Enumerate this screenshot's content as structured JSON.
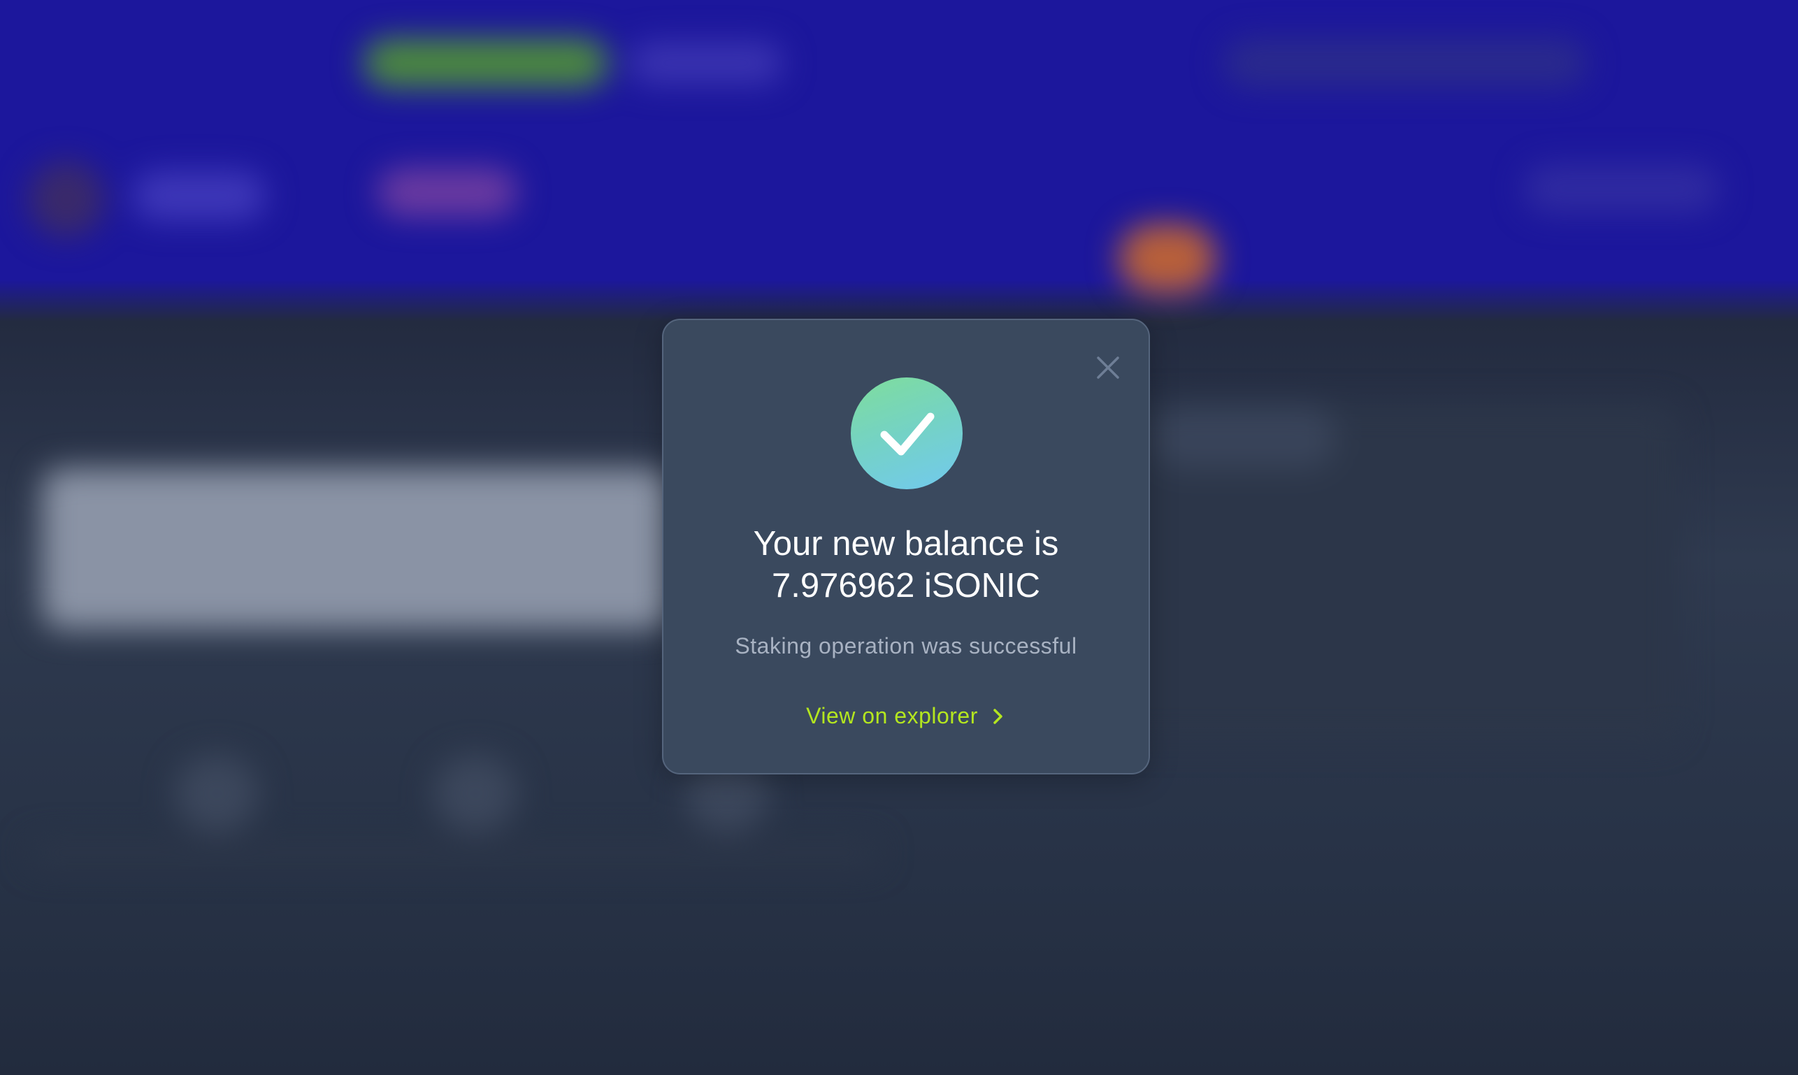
{
  "modal": {
    "title_line1": "Your new balance is",
    "title_line2": "7.976962 iSONIC",
    "subtitle": "Staking operation was successful",
    "explorer_link": "View on explorer",
    "close_icon": "close-icon",
    "success_icon": "checkmark-circle-icon",
    "chevron_icon": "chevron-right-icon"
  },
  "colors": {
    "accent": "#b4e61f",
    "modal_bg": "#3a495e",
    "header_bg": "#1c179c",
    "page_bg": "#222b3d"
  }
}
